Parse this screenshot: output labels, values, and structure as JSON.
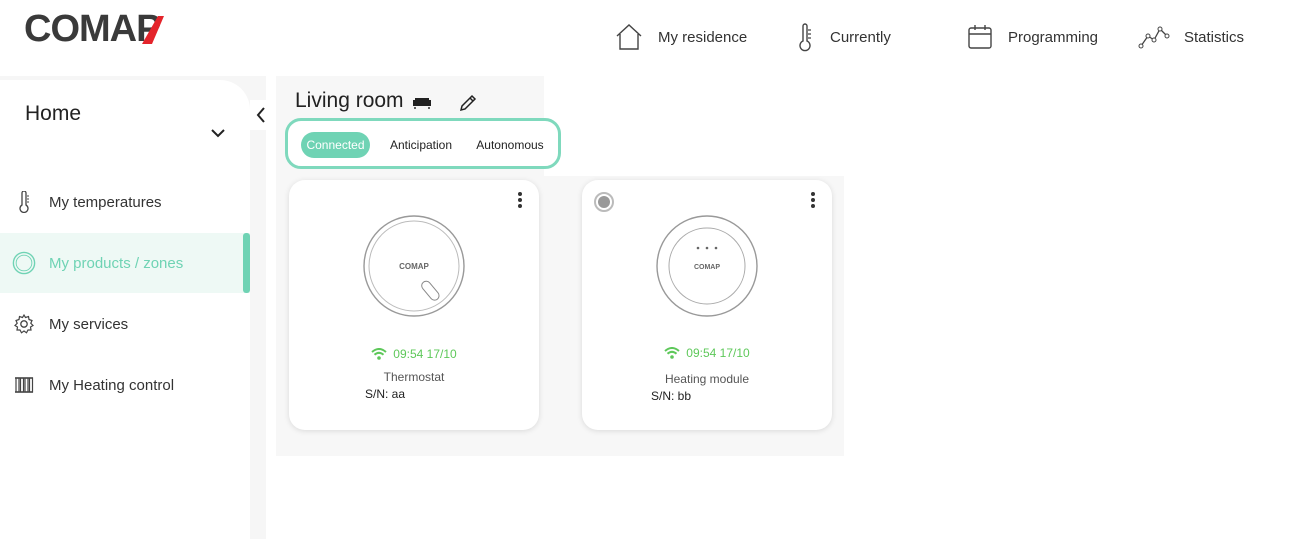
{
  "brand": {
    "logo_text": "COMAP",
    "accent": "#6fd3b4",
    "logo_red": "#e4242b",
    "logo_dark": "#3a3a3a"
  },
  "nav": [
    {
      "label": "My residence",
      "icon": "house-icon"
    },
    {
      "label": "Currently",
      "icon": "thermometer-icon"
    },
    {
      "label": "Programming",
      "icon": "calendar-icon"
    },
    {
      "label": "Statistics",
      "icon": "chart-line-icon"
    }
  ],
  "sidebar": {
    "title": "Home",
    "items": [
      {
        "label": "My temperatures",
        "icon": "thermometer-icon",
        "active": false
      },
      {
        "label": "My products / zones",
        "icon": "zone-circle-icon",
        "active": true
      },
      {
        "label": "My services",
        "icon": "gear-icon",
        "active": false
      },
      {
        "label": "My Heating control",
        "icon": "radiator-icon",
        "active": false
      }
    ]
  },
  "room": {
    "name": "Living room",
    "icon": "sofa-icon"
  },
  "modes": [
    {
      "label": "Connected",
      "selected": true
    },
    {
      "label": "Anticipation",
      "selected": false
    },
    {
      "label": "Autonomous",
      "selected": false
    }
  ],
  "devices": [
    {
      "type": "Thermostat",
      "sn": "S/N: aa",
      "last_seen": "09:54 17/10",
      "device_brand": "COMAP"
    },
    {
      "type": "Heating module",
      "sn": "S/N: bb",
      "last_seen": "09:54 17/10",
      "device_brand": "COMAP"
    }
  ]
}
